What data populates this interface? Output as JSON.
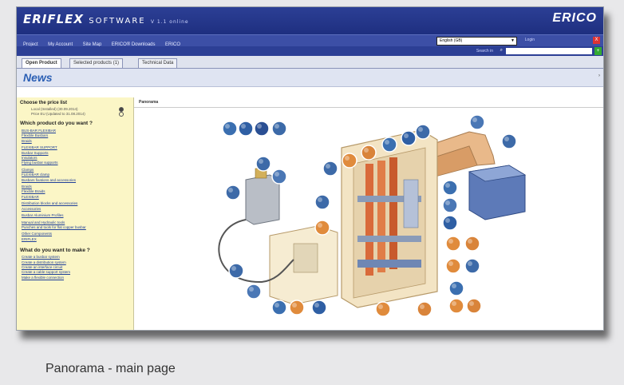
{
  "app": {
    "brand": "ERIFLEX",
    "brand_sub": "SOFTWARE",
    "version": "V 1.1 online",
    "company": "ERICO"
  },
  "menu": {
    "items": [
      "Project",
      "My Account",
      "Site Map",
      "ERICO® Downloads",
      "ERICO"
    ],
    "language": "English (GB)",
    "login": "Login",
    "close": "X"
  },
  "search": {
    "label": "Search in",
    "go": "+"
  },
  "tabs": [
    {
      "label": "Open Product"
    },
    {
      "label": "Selected products (1)"
    },
    {
      "label": "Technical Data"
    }
  ],
  "news_title": "News",
  "left": {
    "price_heading": "Choose the price list",
    "price_lists": [
      "Local (Installed) (30.09.2014)",
      "Price EU (Updated to 31.08.2014)"
    ],
    "product_heading": "Which product do you want ?",
    "product_links": [
      [
        "BUS-BAR FLEXIBAR",
        "Flexible Busbars",
        "Braids"
      ],
      [
        "FLEXIBAR SUPPORT",
        "Busbar Supports",
        "Insulators",
        "Flying busbar supports"
      ],
      [
        "Clamps",
        "FLEXIBAR clamp",
        "Busbars fixations and accessories"
      ],
      [
        "Braids",
        "Flexible Braids",
        "FLEXIBAR"
      ],
      [
        "Distribution blocks and accessories",
        "Accessories"
      ],
      [
        "Busbar Aluminium Profiles"
      ],
      [
        "Manual and Hydraulic tools",
        "Punches and tools for flat copper busbar"
      ],
      [
        "Other Components",
        "ERIFLEX"
      ]
    ],
    "make_heading": "What do you want to make ?",
    "make_links": [
      "Create a busbar system",
      "Create a distribution system",
      "Create an interface circuit",
      "Create a cable support system",
      "Make a flexible connection"
    ]
  },
  "panorama_label": "Panorama",
  "caption": "Panorama - main page",
  "colors": {
    "header": "#2c3f95",
    "menu": "#3c4fa6",
    "news_text": "#2b5fb4",
    "sidebar": "#fbf6c6",
    "link": "#1f3f99"
  }
}
